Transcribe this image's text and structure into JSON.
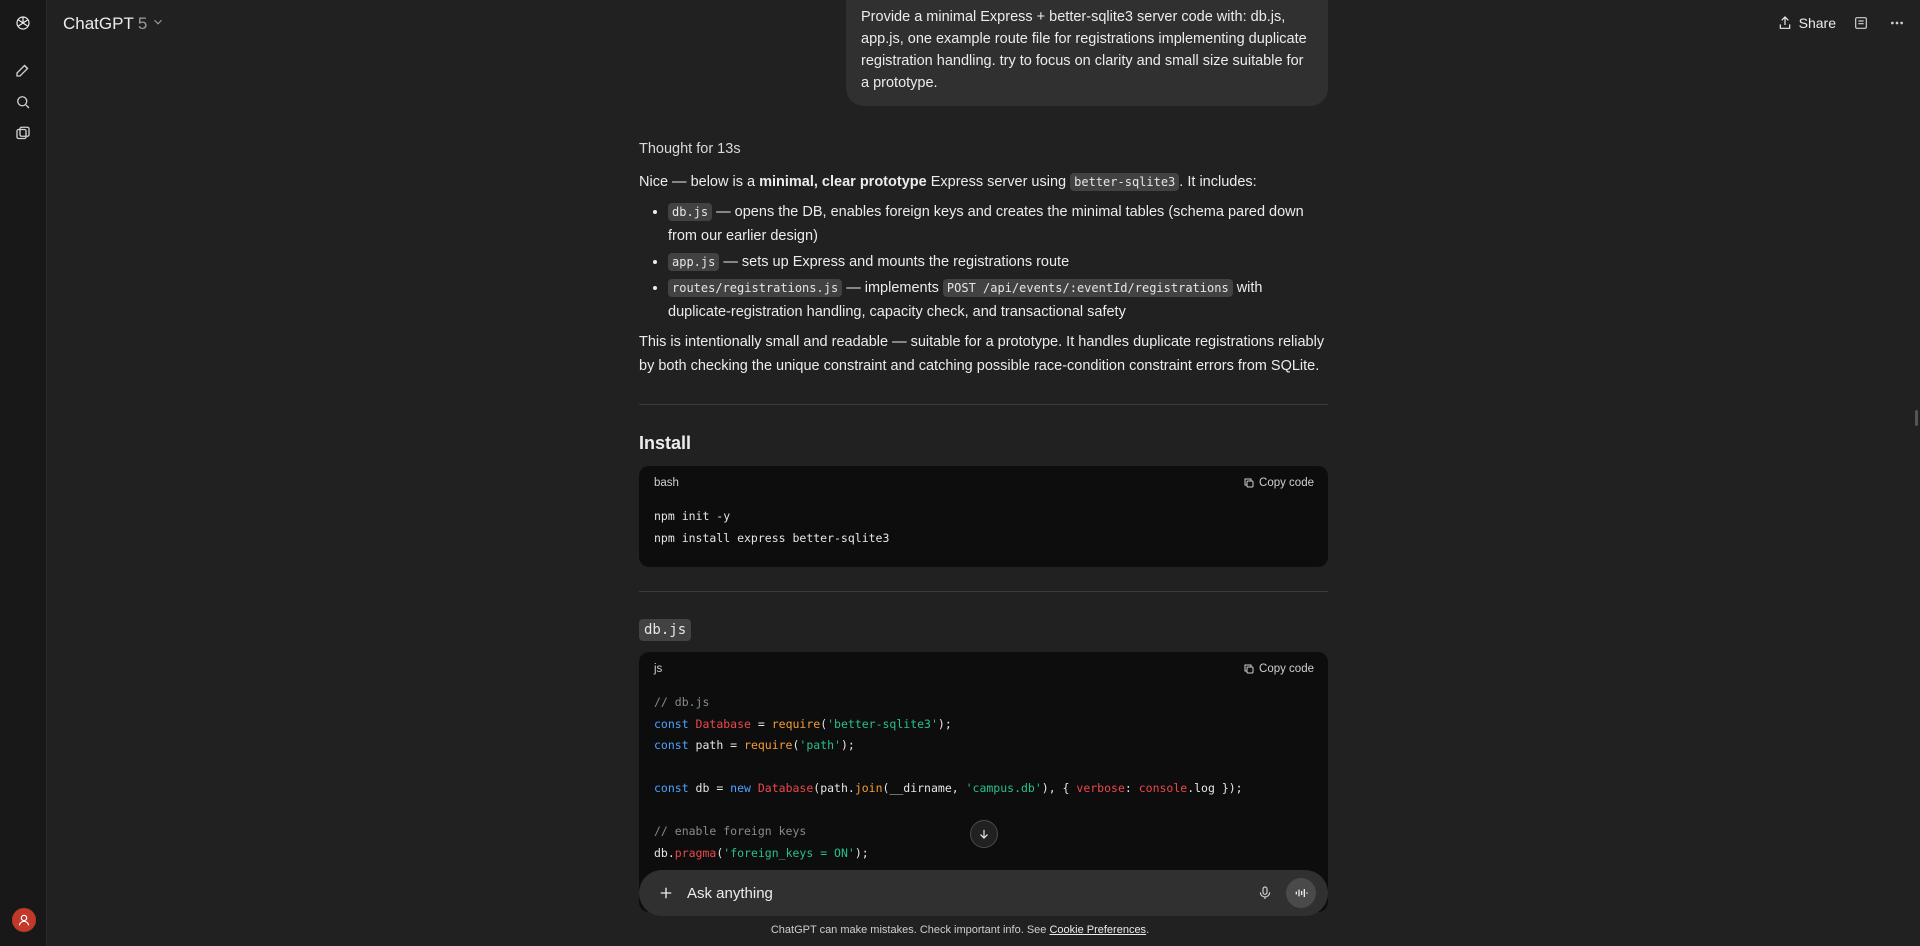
{
  "header": {
    "model_name": "ChatGPT",
    "model_version": "5",
    "share_label": "Share"
  },
  "user_message": "Provide a minimal Express + better-sqlite3 server code with: db.js, app.js, one example route file for registrations implementing duplicate registration handling. try to focus on clarity and small size suitable for a prototype.",
  "response": {
    "thought": "Thought for 13s",
    "intro": {
      "p1": "Nice — below is a ",
      "b1": "minimal, clear prototype",
      "p2": " Express server using ",
      "c1": "better-sqlite3",
      "p3": ". It includes:"
    },
    "bullets": [
      {
        "code": "db.js",
        "text": " — opens the DB, enables foreign keys and creates the minimal tables (schema pared down from our earlier design)"
      },
      {
        "code": "app.js",
        "text": " — sets up Express and mounts the registrations route"
      },
      {
        "code": "routes/registrations.js",
        "text_a": " — implements ",
        "code2": "POST /api/events/:eventId/registrations",
        "text_b": " with duplicate-registration handling, capacity check, and transactional safety"
      }
    ],
    "summary": "This is intentionally small and readable — suitable for a prototype. It handles duplicate registrations reliably by both checking the unique constraint and catching possible race-condition constraint errors from SQLite."
  },
  "install": {
    "heading": "Install",
    "lang": "bash",
    "copy_label": "Copy code",
    "lines": [
      "npm init -y",
      "npm install express better-sqlite3"
    ]
  },
  "dbjs": {
    "heading": "db.js",
    "lang": "js",
    "copy_label": "Copy code",
    "l1": "// db.js",
    "l2": {
      "kw": "const",
      "name": " Database",
      "eq": " = ",
      "fn": "require",
      "open": "(",
      "str": "'better-sqlite3'",
      "close": ");"
    },
    "l3": {
      "kw": "const",
      "name": " path = ",
      "fn": "require",
      "open": "(",
      "str": "'path'",
      "close": ");"
    },
    "l4": {
      "kw": "const",
      "a": " db = ",
      "kw2": "new",
      "cls": " Database",
      "b": "(path.",
      "fn": "join",
      "c": "(__dirname, ",
      "str": "'campus.db'",
      "d": "), { ",
      "prop": "verbose",
      "e": ": ",
      "prop2": "console",
      "f": ".log });"
    },
    "l5": "// enable foreign keys",
    "l6": {
      "a": "db.",
      "fn": "pragma",
      "b": "(",
      "str": "'foreign_keys = ON'",
      "c": ");"
    }
  },
  "composer": {
    "placeholder": "Ask anything"
  },
  "footer": {
    "text": "ChatGPT can make mistakes. Check important info. See ",
    "link": "Cookie Preferences",
    "end": "."
  }
}
